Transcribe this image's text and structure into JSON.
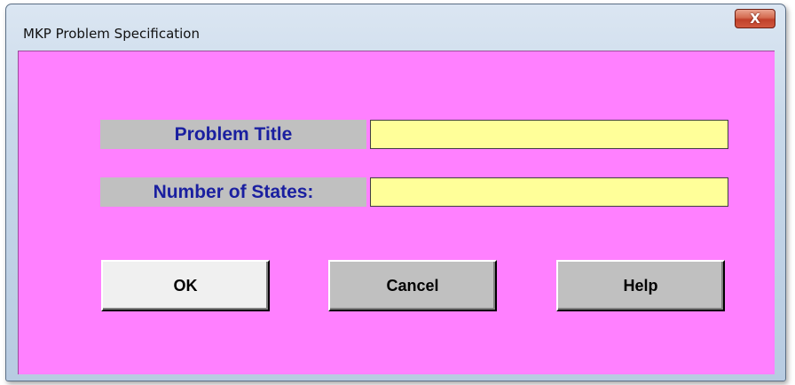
{
  "window": {
    "title": "MKP Problem Specification",
    "close_glyph": "X"
  },
  "form": {
    "problem_title": {
      "label": "Problem Title",
      "value": ""
    },
    "number_of_states": {
      "label": "Number of States:",
      "value": ""
    }
  },
  "buttons": {
    "ok_label": "OK",
    "cancel_label": "Cancel",
    "help_label": "Help"
  },
  "colors": {
    "client_background": "#ff80ff",
    "label_background": "#c0c0c0",
    "label_text": "#1a1fa0",
    "input_background": "#ffff99"
  }
}
